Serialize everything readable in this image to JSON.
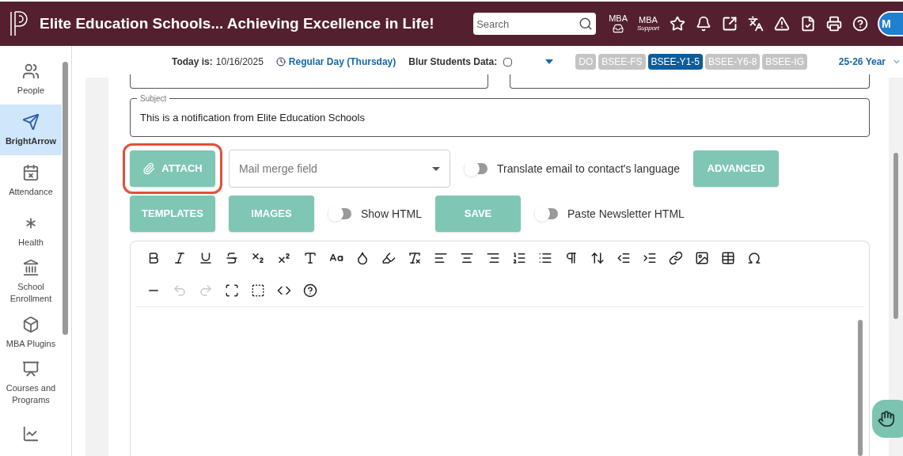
{
  "header": {
    "title": "Elite Education Schools... Achieving Excellence in Life!",
    "search": {
      "placeholder": "Search"
    },
    "mba_button": "MBA",
    "mba_support": {
      "top": "MBA",
      "bottom": "Support"
    },
    "icons": [
      {
        "kind": "star"
      },
      {
        "kind": "bell"
      },
      {
        "kind": "external"
      },
      {
        "kind": "translate"
      },
      {
        "kind": "warning"
      },
      {
        "kind": "checklist"
      },
      {
        "kind": "print"
      },
      {
        "kind": "help"
      }
    ],
    "avatar": "M"
  },
  "sidebar": {
    "items": [
      {
        "label": "People",
        "kind": "people",
        "selected": false
      },
      {
        "label": "BrightArrow",
        "kind": "arrow",
        "selected": true
      },
      {
        "label": "Attendance",
        "kind": "attendance",
        "selected": false
      },
      {
        "label": "Health",
        "kind": "health",
        "selected": false
      },
      {
        "label": "School Enrollment",
        "kind": "school",
        "selected": false
      },
      {
        "label": "MBA Plugins",
        "kind": "plugins",
        "selected": false
      },
      {
        "label": "Courses and Programs",
        "kind": "courses",
        "selected": false
      },
      {
        "kind": "chart",
        "selected": false
      }
    ]
  },
  "subheader": {
    "today_label": "Today is:",
    "date": "10/16/2025",
    "day": "Regular Day (Thursday)",
    "blur_label": "Blur Students Data:",
    "blur_checked": false,
    "schools": [
      {
        "label": "DO",
        "selected": false
      },
      {
        "label": "BSEE-FS",
        "selected": false
      },
      {
        "label": "BSEE-Y1-5",
        "selected": true
      },
      {
        "label": "BSEE-Y6-8",
        "selected": false
      },
      {
        "label": "BSEE-IG",
        "selected": false
      }
    ],
    "year": "25-26 Year"
  },
  "form": {
    "subject_label": "Subject",
    "subject_value": "This is a notification from Elite Education Schools",
    "row1": [
      {
        "kind": "button",
        "label": "ATTACH",
        "icon": true,
        "highlighted": true
      },
      {
        "kind": "select",
        "placeholder": "Mail merge field"
      },
      {
        "kind": "toggle",
        "label": "Translate email to contact's language",
        "on": false
      },
      {
        "kind": "button",
        "label": "ADVANCED",
        "icon": false,
        "highlighted": false
      }
    ],
    "row2": [
      {
        "kind": "button",
        "label": "TEMPLATES",
        "icon": false,
        "highlighted": false
      },
      {
        "kind": "button",
        "label": "IMAGES",
        "icon": false,
        "highlighted": false
      },
      {
        "kind": "toggle",
        "label": "Show HTML",
        "on": false
      },
      {
        "kind": "button",
        "label": "SAVE",
        "icon": false,
        "highlighted": false
      },
      {
        "kind": "toggle",
        "label": "Paste Newsletter HTML",
        "on": false
      }
    ]
  },
  "editor": {
    "toolbar": [
      [
        {
          "kind": "bold",
          "disabled": false
        },
        {
          "kind": "italic",
          "disabled": false
        },
        {
          "kind": "underline",
          "disabled": false
        },
        {
          "kind": "strike",
          "disabled": false
        },
        {
          "kind": "subscript",
          "disabled": false
        },
        {
          "kind": "superscript",
          "disabled": false
        },
        {
          "kind": "font",
          "disabled": false
        },
        {
          "kind": "size",
          "disabled": false
        },
        {
          "kind": "color",
          "disabled": false
        },
        {
          "kind": "highlight",
          "disabled": false
        },
        {
          "kind": "clear",
          "disabled": false
        },
        {
          "kind": "left",
          "disabled": false
        },
        {
          "kind": "center",
          "disabled": false
        },
        {
          "kind": "right",
          "disabled": false
        },
        {
          "kind": "ol",
          "disabled": false
        },
        {
          "kind": "ul",
          "disabled": false
        },
        {
          "kind": "paragraph",
          "disabled": false
        },
        {
          "kind": "lineheight",
          "disabled": false
        },
        {
          "kind": "outdent",
          "disabled": false
        },
        {
          "kind": "indent",
          "disabled": false
        },
        {
          "kind": "link",
          "disabled": false
        },
        {
          "kind": "image",
          "disabled": false
        },
        {
          "kind": "table",
          "disabled": false
        },
        {
          "kind": "omega",
          "disabled": false
        }
      ],
      [
        {
          "kind": "hr",
          "disabled": false
        },
        {
          "kind": "undo",
          "disabled": true
        },
        {
          "kind": "redo",
          "disabled": true
        },
        {
          "kind": "fullscreen",
          "disabled": false
        },
        {
          "kind": "select",
          "disabled": false
        },
        {
          "kind": "code",
          "disabled": false
        },
        {
          "kind": "help",
          "disabled": false
        }
      ]
    ]
  }
}
